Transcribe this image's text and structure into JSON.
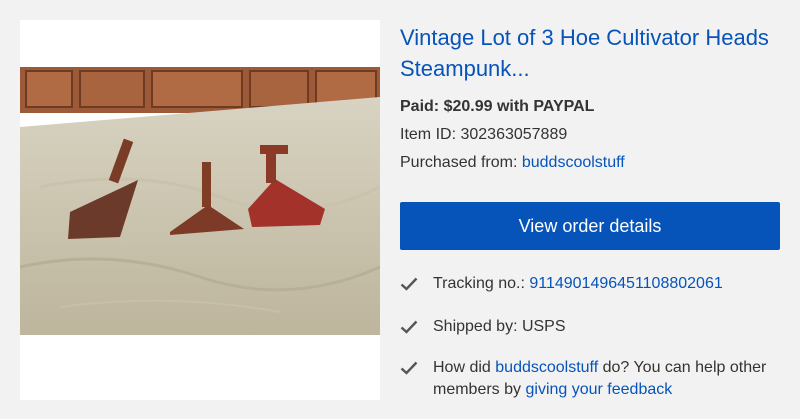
{
  "item": {
    "title": "Vintage Lot of 3 Hoe Cultivator Heads Steampunk...",
    "image_alt": "Three rusty hoe cultivator heads on a cloth-covered table"
  },
  "payment": {
    "label": "Paid: $20.99 with PAYPAL"
  },
  "item_id": {
    "label": "Item ID:",
    "value": "302363057889"
  },
  "purchased_from": {
    "label": "Purchased from:",
    "seller": "buddscoolstuff"
  },
  "actions": {
    "view_order_label": "View order details"
  },
  "status": {
    "tracking_label": "Tracking no.:",
    "tracking_number": "9114901496451108802061",
    "shipped_label": "Shipped by: USPS",
    "feedback_prefix": "How did",
    "feedback_seller": "buddscoolstuff",
    "feedback_middle": "do? You can help other members by",
    "feedback_link": "giving your feedback"
  },
  "icons": {
    "status_check": "check-icon"
  },
  "colors": {
    "link": "#0654ba",
    "button_bg": "#0654ba",
    "button_text": "#ffffff",
    "page_bg": "#f2f2f2",
    "text": "#333333"
  }
}
